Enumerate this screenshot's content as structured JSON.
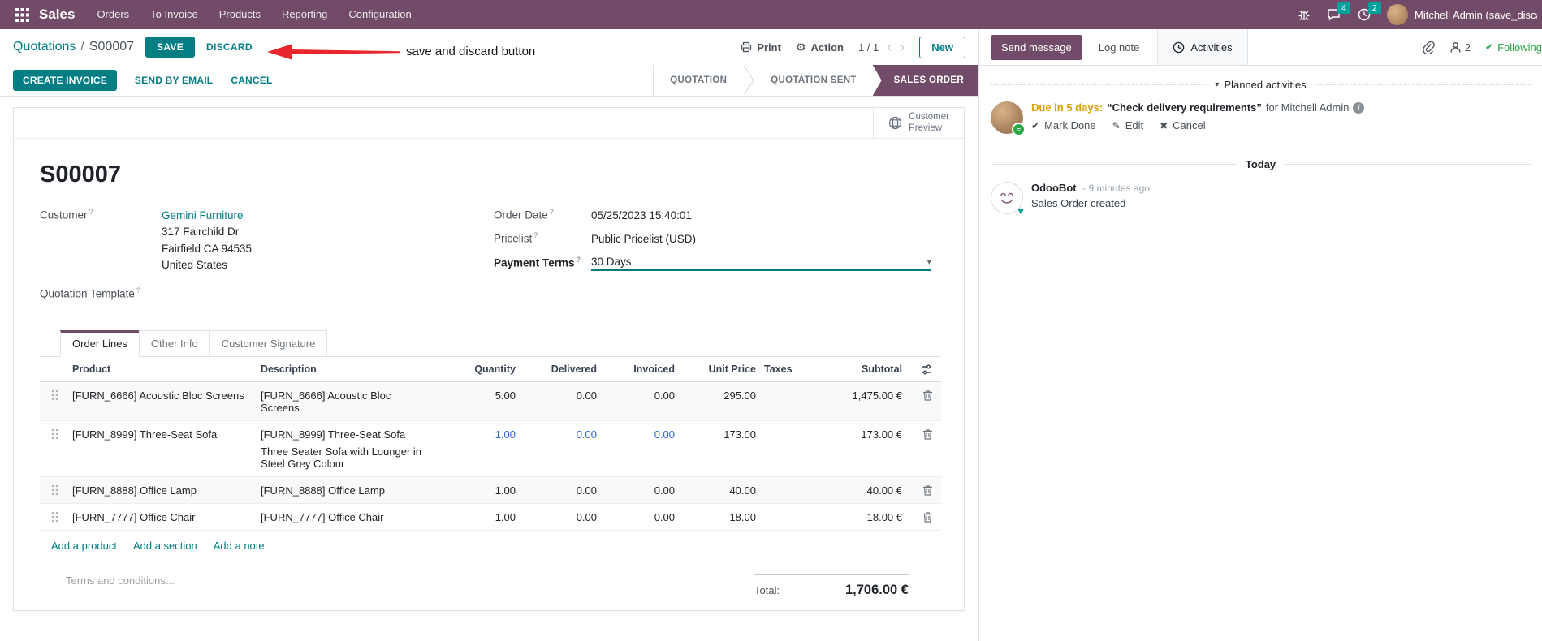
{
  "icons": {
    "caret_down": "▾",
    "check": "✔",
    "pencil": "✎",
    "cross": "✖",
    "gear": "⚙",
    "chevron_left": "‹",
    "chevron_right": "›",
    "help": "?",
    "heart": "♥",
    "info": "i",
    "badge_lines": "≡"
  },
  "colors": {
    "brand": "#714B67",
    "accent": "#017E84",
    "badge": "#00A09D",
    "warning": "#d9a000",
    "success": "#28a745",
    "edited_blue": "#2C67C9",
    "arrow_red": "#e8262b"
  },
  "nav": {
    "app": "Sales",
    "items": [
      {
        "label": "Orders"
      },
      {
        "label": "To Invoice"
      },
      {
        "label": "Products"
      },
      {
        "label": "Reporting"
      },
      {
        "label": "Configuration"
      }
    ],
    "chat_badge": "4",
    "clock_badge": "2",
    "user": "Mitchell Admin (save_discard)"
  },
  "control": {
    "breadcrumb_parent": "Quotations",
    "breadcrumb_sep": "/",
    "breadcrumb_current": "S00007",
    "save": "SAVE",
    "discard": "DISCARD",
    "print": "Print",
    "action": "Action",
    "pager": "1 / 1",
    "new": "New"
  },
  "statusrow": {
    "create_invoice": "CREATE INVOICE",
    "send_by_email": "SEND BY EMAIL",
    "cancel": "CANCEL",
    "steps": [
      {
        "label": "QUOTATION"
      },
      {
        "label": "QUOTATION SENT"
      },
      {
        "label": "SALES ORDER"
      }
    ]
  },
  "annotation": {
    "text": "save and discard button"
  },
  "sheet": {
    "preview_line1": "Customer",
    "preview_line2": "Preview",
    "title": "S00007",
    "fields": {
      "customer_label": "Customer",
      "customer_name": "Gemini Furniture",
      "address1": "317 Fairchild Dr",
      "address2": "Fairfield CA 94535",
      "address3": "United States",
      "template_label": "Quotation Template",
      "order_date_label": "Order Date",
      "order_date": "05/25/2023 15:40:01",
      "pricelist_label": "Pricelist",
      "pricelist": "Public Pricelist (USD)",
      "payment_terms_label": "Payment Terms",
      "payment_terms": "30 Days"
    },
    "tabs": [
      {
        "label": "Order Lines"
      },
      {
        "label": "Other Info"
      },
      {
        "label": "Customer Signature"
      }
    ],
    "table": {
      "headers": {
        "product": "Product",
        "description": "Description",
        "quantity": "Quantity",
        "delivered": "Delivered",
        "invoiced": "Invoiced",
        "unit_price": "Unit Price",
        "taxes": "Taxes",
        "subtotal": "Subtotal"
      },
      "rows": [
        {
          "product": "[FURN_6666] Acoustic Bloc Screens",
          "description": "[FURN_6666] Acoustic Bloc Screens",
          "quantity": "5.00",
          "delivered": "0.00",
          "invoiced": "0.00",
          "unit_price": "295.00",
          "subtotal": "1,475.00 €"
        },
        {
          "product": "[FURN_8999] Three-Seat Sofa",
          "description": "[FURN_8999] Three-Seat Sofa",
          "description2": "Three Seater Sofa with Lounger in Steel Grey Colour",
          "quantity": "1.00",
          "delivered": "0.00",
          "invoiced": "0.00",
          "unit_price": "173.00",
          "subtotal": "173.00 €"
        },
        {
          "product": "[FURN_8888] Office Lamp",
          "description": "[FURN_8888] Office Lamp",
          "quantity": "1.00",
          "delivered": "0.00",
          "invoiced": "0.00",
          "unit_price": "40.00",
          "subtotal": "40.00 €"
        },
        {
          "product": "[FURN_7777] Office Chair",
          "description": "[FURN_7777] Office Chair",
          "quantity": "1.00",
          "delivered": "0.00",
          "invoiced": "0.00",
          "unit_price": "18.00",
          "subtotal": "18.00 €"
        }
      ],
      "add_product": "Add a product",
      "add_section": "Add a section",
      "add_note": "Add a note"
    },
    "terms_placeholder": "Terms and conditions...",
    "total_label": "Total:",
    "total_value": "1,706.00 €"
  },
  "chatter": {
    "send_message": "Send message",
    "log_note": "Log note",
    "activities": "Activities",
    "followers_count": "2",
    "following": "Following",
    "planned_header": "Planned activities",
    "activity": {
      "due": "Due in 5 days:",
      "summary": "“Check delivery requirements”",
      "for_text": "for Mitchell Admin",
      "mark_done": "Mark Done",
      "edit": "Edit",
      "cancel": "Cancel"
    },
    "today": "Today",
    "message": {
      "author": "OdooBot",
      "time": "- 9 minutes ago",
      "body": "Sales Order created"
    }
  }
}
